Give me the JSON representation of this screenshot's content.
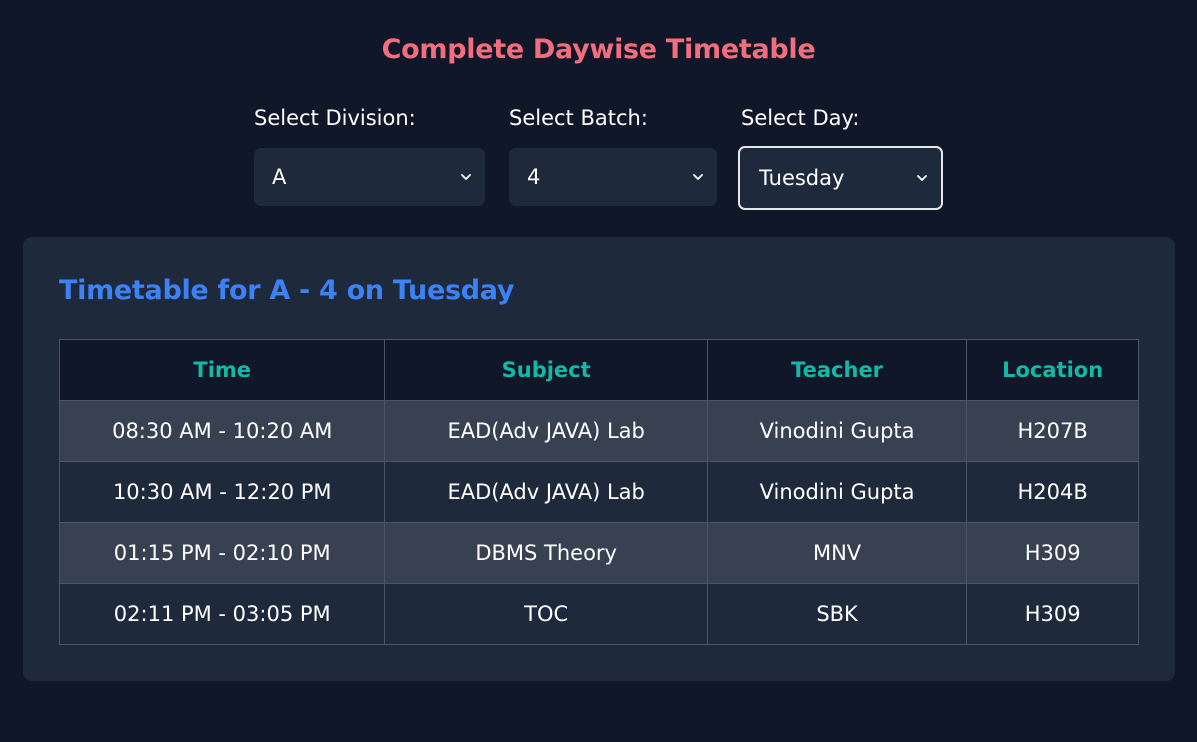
{
  "page": {
    "title": "Complete Daywise Timetable"
  },
  "filters": {
    "division": {
      "label": "Select Division:",
      "value": "A"
    },
    "batch": {
      "label": "Select Batch:",
      "value": "4"
    },
    "day": {
      "label": "Select Day:",
      "value": "Tuesday"
    }
  },
  "timetable": {
    "heading": "Timetable for A - 4 on Tuesday",
    "columns": [
      "Time",
      "Subject",
      "Teacher",
      "Location"
    ],
    "rows": [
      [
        "08:30 AM - 10:20 AM",
        "EAD(Adv JAVA) Lab",
        "Vinodini Gupta",
        "H207B"
      ],
      [
        "10:30 AM - 12:20 PM",
        "EAD(Adv JAVA) Lab",
        "Vinodini Gupta",
        "H204B"
      ],
      [
        "01:15 PM - 02:10 PM",
        "DBMS Theory",
        "MNV",
        "H309"
      ],
      [
        "02:11 PM - 03:05 PM",
        "TOC",
        "SBK",
        "H309"
      ]
    ]
  },
  "colors": {
    "background": "#0f1729",
    "title_accent": "#f26d7d",
    "heading_accent": "#3b82f6",
    "column_header": "#14b8a6",
    "panel": "#1e293b",
    "row_alt": "#374151"
  },
  "icons": {
    "select_arrow": "chevron-down-icon"
  }
}
